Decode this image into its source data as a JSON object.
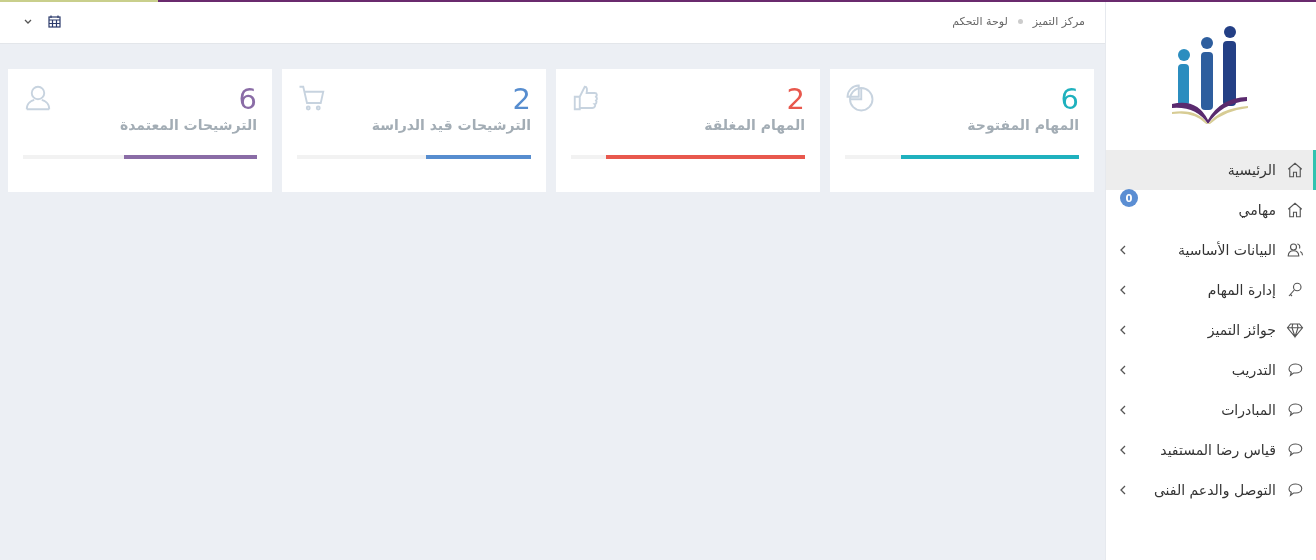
{
  "top_progress": {
    "level": 0.88
  },
  "breadcrumb": [
    "مركز التميز",
    "لوحة التحكم"
  ],
  "stats": [
    {
      "value": "6",
      "label": "المهام المفتوحة",
      "color": "#1fb1be",
      "level": 0.76
    },
    {
      "value": "2",
      "label": "المهام المغلقة",
      "color": "#e8584d",
      "level": 0.85
    },
    {
      "value": "2",
      "label": "الترشيحات قيد الدراسة",
      "color": "#578dcf",
      "level": 0.45
    },
    {
      "value": "6",
      "label": "الترشيحات المعتمدة",
      "color": "#8a6ca6",
      "level": 0.57
    }
  ],
  "sidebar": {
    "items": [
      {
        "label": "الرئيسية",
        "kind": "link",
        "selected": true
      },
      {
        "label": "مهامي",
        "kind": "link",
        "selected": false,
        "badge": "0"
      },
      {
        "label": "البيانات الأساسية",
        "kind": "submenu",
        "selected": false
      },
      {
        "label": "إدارة المهام",
        "kind": "submenu",
        "selected": false
      },
      {
        "label": "جوائز التميز",
        "kind": "submenu",
        "selected": false
      },
      {
        "label": "التدريب",
        "kind": "submenu",
        "selected": false
      },
      {
        "label": "المبادرات",
        "kind": "submenu",
        "selected": false
      },
      {
        "label": "قياس رضا المستفيد",
        "kind": "submenu",
        "selected": false
      },
      {
        "label": "التوصل والدعم الفنى",
        "kind": "submenu",
        "selected": false
      }
    ]
  }
}
